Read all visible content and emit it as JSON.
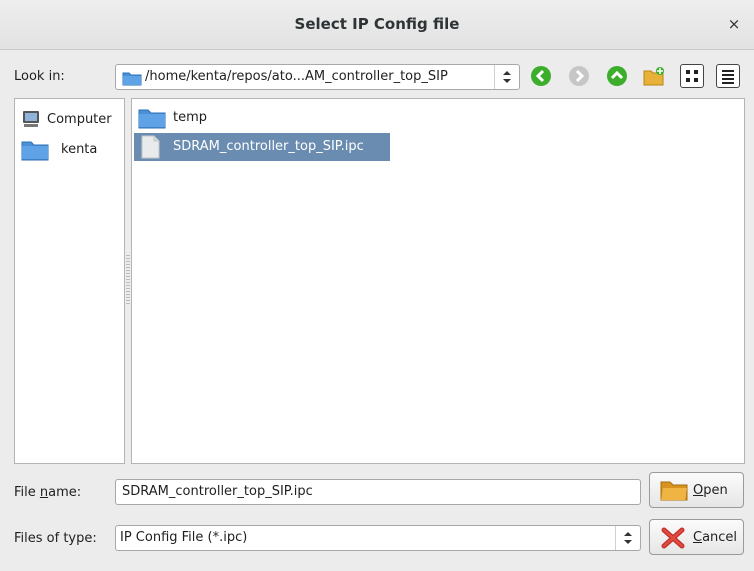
{
  "dialog": {
    "title": "Select IP Config file",
    "close_glyph": "×"
  },
  "toolbar": {
    "look_in_label": "Look in:",
    "path": "/home/kenta/repos/ato...AM_controller_top_SIP",
    "buttons": [
      "back-icon",
      "forward-icon",
      "up-icon",
      "new-folder-icon",
      "list-view-icon",
      "detail-view-icon"
    ]
  },
  "sidebar": {
    "items": [
      {
        "label": "Computer",
        "icon": "computer-icon"
      },
      {
        "label": "kenta",
        "icon": "folder-icon"
      }
    ]
  },
  "files": [
    {
      "name": "temp",
      "type": "folder",
      "selected": false
    },
    {
      "name": "SDRAM_controller_top_SIP.ipc",
      "type": "file",
      "selected": true
    }
  ],
  "file_name": {
    "label_pre": "File ",
    "label_mnemonic": "n",
    "label_post": "ame:",
    "value": "SDRAM_controller_top_SIP.ipc"
  },
  "file_type": {
    "label": "Files of type:",
    "value": "IP Config File (*.ipc)"
  },
  "actions": {
    "open": {
      "mnemonic": "O",
      "rest": "pen"
    },
    "cancel": {
      "mnemonic": "C",
      "rest": "ancel"
    }
  },
  "colors": {
    "selection": "#6a8cb0",
    "folder": "#4a90d9",
    "nav_green": "#3cae2c"
  }
}
